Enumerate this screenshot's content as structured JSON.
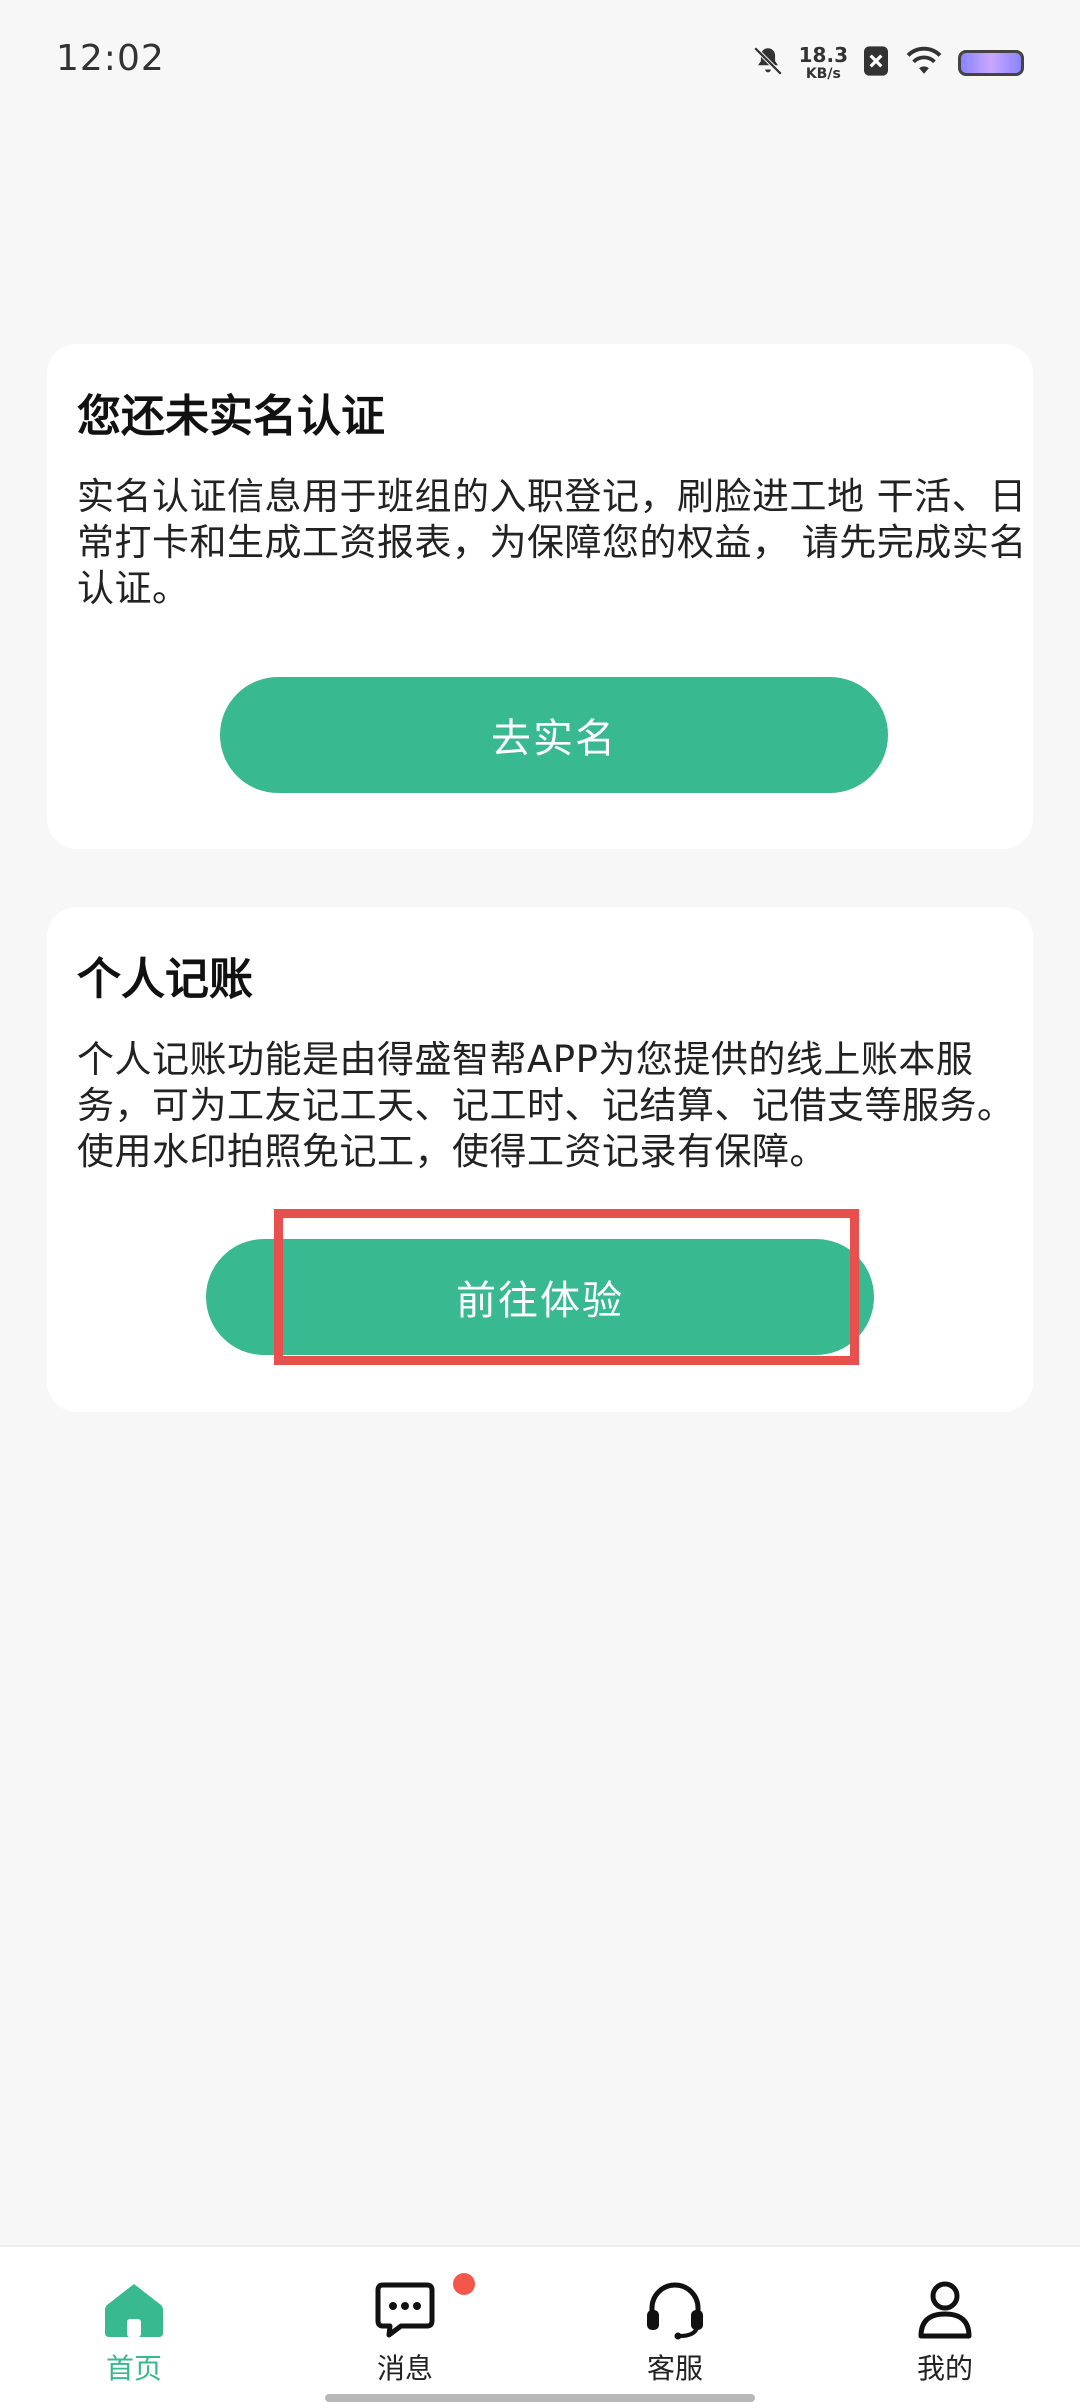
{
  "status_bar": {
    "time": "12:02",
    "net_speed_value": "18.3",
    "net_speed_unit": "KB/s",
    "icons": [
      "mute-icon",
      "net-speed",
      "sim-off-icon",
      "wifi-icon",
      "battery-icon"
    ]
  },
  "cards": [
    {
      "title": "您还未实名认证",
      "description": "实名认证信息用于班组的入职登记，刷脸进工地 干活、日常打卡和生成工资报表，为保障您的权益， 请先完成实名认证。",
      "button_label": "去实名"
    },
    {
      "title": "个人记账",
      "description": "个人记账功能是由得盛智帮APP为您提供的线上账本服务，可为工友记工天、记工时、记结算、记借支等服务。使用水印拍照免记工，使得工资记录有保障。",
      "button_label": "前往体验"
    }
  ],
  "bottom_nav": {
    "items": [
      {
        "label": "首页",
        "icon": "home-icon",
        "active": true
      },
      {
        "label": "消息",
        "icon": "message-icon",
        "active": false,
        "badge": true
      },
      {
        "label": "客服",
        "icon": "headset-icon",
        "active": false
      },
      {
        "label": "我的",
        "icon": "user-icon",
        "active": false
      }
    ]
  },
  "colors": {
    "accent": "#39b98f",
    "background": "#f7f7f7",
    "badge": "#f2574a",
    "highlight": "#e8504f"
  }
}
